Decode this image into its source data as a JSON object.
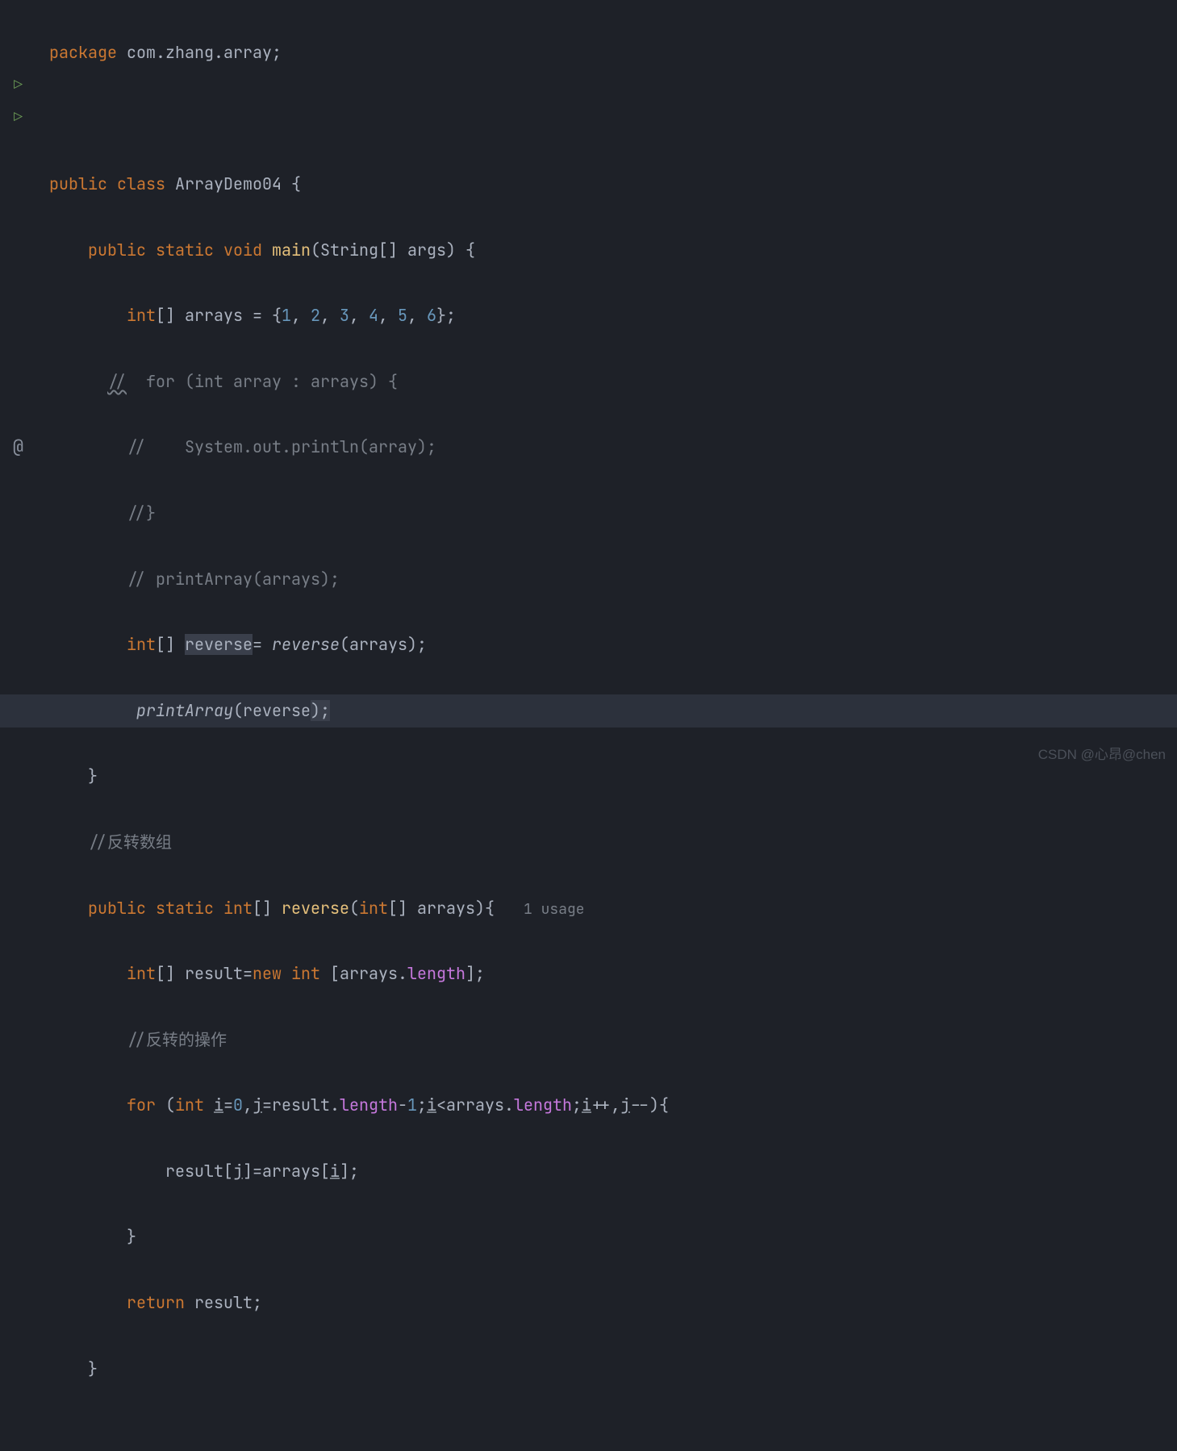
{
  "gutter": {
    "run1": "▷",
    "run2": "▷",
    "at": "@"
  },
  "code": {
    "l1": {
      "kw": "package",
      "pkg": " com.zhang.array;"
    },
    "l3": {
      "kw1": "public",
      "kw2": "class",
      "name": " ArrayDemo04 ",
      "brace": "{"
    },
    "l4": {
      "kw1": "public",
      "kw2": "static",
      "kw3": "void",
      "name": "main",
      "params": "(String[] args) {"
    },
    "l5": {
      "type": "int",
      "brackets": "[] ",
      "var": "arrays = {",
      "n1": "1",
      "n2": "2",
      "n3": "3",
      "n4": "4",
      "n5": "5",
      "n6": "6",
      "end": "};"
    },
    "l6": {
      "c": "//",
      "rest": "  for (int array : arrays) {"
    },
    "l7": {
      "c": "//    System.out.println(array);"
    },
    "l8": {
      "c": "//}"
    },
    "l9": {
      "c": "// printArray(arrays);"
    },
    "l10": {
      "type": "int",
      "brackets": "[] ",
      "var": "reverse",
      "eq": "= ",
      "call": "reverse",
      "args": "(arrays);"
    },
    "l11": {
      "call": "printArray",
      "args": "(reverse",
      ");": ");"
    },
    "l12": {
      "brace": "}"
    },
    "l13": {
      "c": "//反转数组"
    },
    "l14": {
      "kw1": "public",
      "kw2": "static",
      "type": "int",
      "brackets": "[] ",
      "name": "reverse",
      "params": "(",
      "ptype": "int",
      "pbrackets": "[] ",
      "pvar": "arrays){",
      "hint": "1 usage"
    },
    "l15": {
      "type": "int",
      "brackets": "[] ",
      "var": "result=",
      "kw": "new",
      "type2": "int",
      "rest": " [arrays.",
      "field": "length",
      "end": "];"
    },
    "l16": {
      "c": "//反转的操作"
    },
    "l17": {
      "kw": "for",
      "open": " (",
      "type": "int",
      "sp": " ",
      "v1": "i",
      "eq1": "=",
      "n1": "0",
      "c1": ",",
      "v2": "j",
      "eq2": "=result.",
      "f1": "length",
      "m1": "-",
      "n2": "1",
      "sc1": ";",
      "v3": "i",
      "lt": "<arrays.",
      "f2": "length",
      "sc2": ";",
      "v4": "i",
      "pp": "++,",
      "v5": "j",
      "mm": "--){"
    },
    "l18": {
      "var": "result[",
      "v1": "j",
      "mid": "]=arrays[",
      "v2": "i",
      "end": "];"
    },
    "l19": {
      "brace": "}"
    },
    "l20": {
      "kw": "return",
      "var": " result;"
    },
    "l21": {
      "brace": "}"
    }
  },
  "watermark": "CSDN @心昂@chen"
}
